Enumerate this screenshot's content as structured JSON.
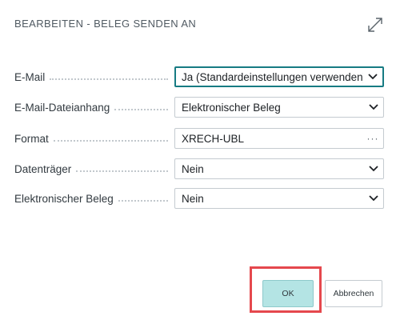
{
  "dialog": {
    "title": "BEARBEITEN - BELEG SENDEN AN",
    "expand_icon": "expand-diagonal-icon"
  },
  "fields": [
    {
      "label": "E-Mail",
      "value": "Ja (Standardeinstellungen verwenden)",
      "control": "dropdown",
      "focused": true
    },
    {
      "label": "E-Mail-Dateianhang",
      "value": "Elektronischer Beleg",
      "control": "dropdown",
      "focused": false
    },
    {
      "label": "Format",
      "value": "XRECH-UBL",
      "control": "lookup",
      "lookup_glyph": "···",
      "focused": false
    },
    {
      "label": "Datenträger",
      "value": "Nein",
      "control": "dropdown",
      "focused": false
    },
    {
      "label": "Elektronischer Beleg",
      "value": "Nein",
      "control": "dropdown",
      "focused": false
    }
  ],
  "buttons": {
    "ok": "OK",
    "cancel": "Abbrechen"
  },
  "colors": {
    "accent": "#177b83",
    "ok_button_bg": "#b4e4e4",
    "highlight_border": "#e5484d"
  }
}
